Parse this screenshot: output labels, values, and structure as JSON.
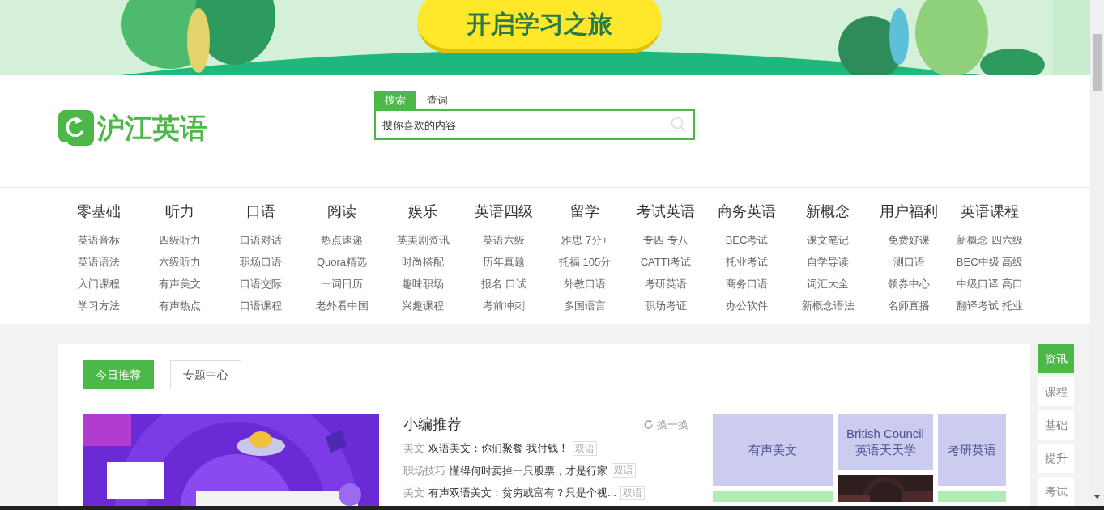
{
  "banner": {
    "button": "开启学习之旅"
  },
  "logo": {
    "text": "沪江英语"
  },
  "search": {
    "tabs": [
      {
        "label": "搜索",
        "selected": true
      },
      {
        "label": "查词",
        "selected": false
      }
    ],
    "placeholder": "搜你喜欢的内容"
  },
  "nav": [
    {
      "heading": "零基础",
      "links": [
        "英语音标",
        "英语语法",
        "入门课程",
        "学习方法"
      ]
    },
    {
      "heading": "听力",
      "links": [
        "四级听力",
        "六级听力",
        "有声美文",
        "有声热点"
      ]
    },
    {
      "heading": "口语",
      "links": [
        "口语对话",
        "职场口语",
        "口语交际",
        "口语课程"
      ]
    },
    {
      "heading": "阅读",
      "links": [
        "热点速递",
        "Quora精选",
        "一词日历",
        "老外看中国"
      ]
    },
    {
      "heading": "娱乐",
      "links": [
        "英美剧资讯",
        "时尚搭配",
        "趣味职场",
        "兴趣课程"
      ]
    },
    {
      "heading": "英语四级",
      "links": [
        "英语六级",
        "历年真题",
        "报名 口试",
        "考前冲刺"
      ]
    },
    {
      "heading": "留学",
      "links": [
        "雅思 7分+",
        "托福 105分",
        "外教口语",
        "多国语言"
      ]
    },
    {
      "heading": "考试英语",
      "links": [
        "专四 专八",
        "CATTI考试",
        "考研英语",
        "职场考证"
      ]
    },
    {
      "heading": "商务英语",
      "links": [
        "BEC考试",
        "托业考试",
        "商务口语",
        "办公软件"
      ]
    },
    {
      "heading": "新概念",
      "links": [
        "课文笔记",
        "自学导读",
        "词汇大全",
        "新概念语法"
      ]
    },
    {
      "heading": "用户福利",
      "links": [
        "免费好课",
        "测口语",
        "领券中心",
        "名师直播"
      ]
    },
    {
      "heading": "英语课程",
      "links": [
        "新概念 四六级",
        "BEC中级 高级",
        "中级口译 高口",
        "翻译考试 托业"
      ]
    }
  ],
  "content_tabs": [
    {
      "label": "今日推荐",
      "selected": true
    },
    {
      "label": "专题中心",
      "selected": false
    }
  ],
  "picks": {
    "title": "小编推荐",
    "refresh": "换一换",
    "items": [
      {
        "tag": "美文",
        "title": "双语美文：你们聚餐 我付钱！",
        "badge": "双语"
      },
      {
        "tag": "职场技巧",
        "title": "懂得何时卖掉一只股票，才是行家",
        "badge": "双语"
      },
      {
        "tag": "美文",
        "title": "有声双语美文：贫穷或富有？只是个视...",
        "badge": "双语"
      }
    ]
  },
  "tiles": [
    {
      "kind": "text",
      "label": "有声美文",
      "color": "#cccdee"
    },
    {
      "kind": "text",
      "label": "British Council\n英语天天学",
      "color": "#cccdee"
    },
    {
      "kind": "text",
      "label": "考研英语",
      "color": "#cccdee"
    },
    {
      "kind": "blank",
      "color": "#b0ecb5"
    },
    {
      "kind": "picture"
    },
    {
      "kind": "blank",
      "color": "#b0ecb5"
    }
  ],
  "side_tabs": [
    {
      "label": "资讯",
      "selected": true
    },
    {
      "label": "课程",
      "selected": false
    },
    {
      "label": "基础",
      "selected": false
    },
    {
      "label": "提升",
      "selected": false
    },
    {
      "label": "考试",
      "selected": false
    }
  ]
}
